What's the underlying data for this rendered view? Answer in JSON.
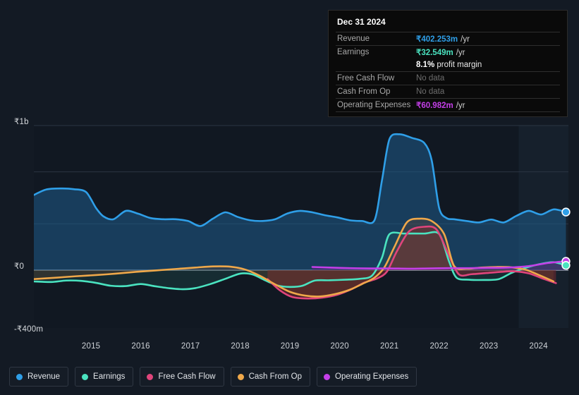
{
  "currency_symbol": "₹",
  "background": "#131a24",
  "tooltip": {
    "date": "Dec 31 2024",
    "rows": [
      {
        "label": "Revenue",
        "value": "₹402.253m",
        "unit": "/yr",
        "color": "#2f9fe8",
        "nodata": false
      },
      {
        "label": "Earnings",
        "value": "₹32.549m",
        "unit": "/yr",
        "color": "#4ae3c0",
        "nodata": false
      },
      {
        "label": "",
        "value": "8.1%",
        "unit": "profit margin",
        "color": "#ffffff",
        "nodata": false,
        "margin_row": true
      },
      {
        "label": "Free Cash Flow",
        "value": "No data",
        "unit": "",
        "color": "#6d6d6d",
        "nodata": true
      },
      {
        "label": "Cash From Op",
        "value": "No data",
        "unit": "",
        "color": "#6d6d6d",
        "nodata": true
      },
      {
        "label": "Operating Expenses",
        "value": "₹60.982m",
        "unit": "/yr",
        "color": "#c43fe8",
        "nodata": false
      }
    ]
  },
  "legend": {
    "items": [
      {
        "label": "Revenue",
        "color": "#2f9fe8"
      },
      {
        "label": "Earnings",
        "color": "#4ae3c0"
      },
      {
        "label": "Free Cash Flow",
        "color": "#e0457b"
      },
      {
        "label": "Cash From Op",
        "color": "#efa84a"
      },
      {
        "label": "Operating Expenses",
        "color": "#c43fe8"
      }
    ]
  },
  "chart_data": {
    "type": "area",
    "title": "",
    "xlabel": "",
    "ylabel": "",
    "ylim": [
      -400,
      1000
    ],
    "y_unit": "m",
    "grid": true,
    "legend_position": "bottom",
    "y_ticks": [
      {
        "label": "₹1b",
        "value": 1000
      },
      {
        "label": "₹0",
        "value": 0
      },
      {
        "label": "-₹400m",
        "value": -400
      }
    ],
    "gridlines": [
      1000,
      680,
      320,
      0
    ],
    "x_ticks": [
      "2015",
      "2016",
      "2017",
      "2018",
      "2019",
      "2020",
      "2021",
      "2022",
      "2023",
      "2024"
    ],
    "x_range": [
      2014.35,
      2025.1
    ],
    "forecast_start": 2024.1,
    "series": [
      {
        "name": "Revenue",
        "color": "#2f9fe8",
        "fill": "rgba(31,92,140,0.55)",
        "x": [
          2014.35,
          2014.6,
          2014.9,
          2015.15,
          2015.4,
          2015.6,
          2015.75,
          2015.95,
          2016.2,
          2016.45,
          2016.7,
          2016.95,
          2017.2,
          2017.45,
          2017.7,
          2017.95,
          2018.2,
          2018.45,
          2018.7,
          2018.95,
          2019.2,
          2019.45,
          2019.7,
          2019.95,
          2020.2,
          2020.45,
          2020.7,
          2020.95,
          2021.2,
          2021.35,
          2021.5,
          2021.7,
          2021.95,
          2022.2,
          2022.35,
          2022.5,
          2022.65,
          2022.8,
          2023.05,
          2023.3,
          2023.55,
          2023.8,
          2024.05,
          2024.3,
          2024.55,
          2024.8,
          2025.05
        ],
        "y": [
          520,
          558,
          565,
          560,
          540,
          430,
          372,
          352,
          410,
          390,
          360,
          352,
          352,
          340,
          305,
          356,
          400,
          368,
          345,
          340,
          352,
          392,
          410,
          400,
          380,
          365,
          345,
          340,
          345,
          620,
          905,
          940,
          915,
          880,
          760,
          430,
          360,
          352,
          340,
          330,
          350,
          330,
          375,
          410,
          385,
          420,
          402
        ]
      },
      {
        "name": "Earnings",
        "color": "#4ae3c0",
        "fill": "rgba(38,94,90,0.30)",
        "x": [
          2014.35,
          2014.7,
          2015.0,
          2015.3,
          2015.6,
          2015.9,
          2016.2,
          2016.5,
          2016.8,
          2017.1,
          2017.35,
          2017.6,
          2017.9,
          2018.2,
          2018.5,
          2018.75,
          2019.0,
          2019.25,
          2019.5,
          2019.75,
          2020.0,
          2020.3,
          2020.6,
          2020.9,
          2021.15,
          2021.35,
          2021.5,
          2021.8,
          2022.2,
          2022.5,
          2022.7,
          2022.85,
          2023.1,
          2023.4,
          2023.7,
          2023.95,
          2024.2,
          2024.5,
          2024.8,
          2025.05
        ],
        "y": [
          -78,
          -82,
          -72,
          -74,
          -88,
          -108,
          -110,
          -96,
          -112,
          -126,
          -132,
          -124,
          -96,
          -60,
          -24,
          -30,
          -70,
          -106,
          -116,
          -108,
          -72,
          -70,
          -66,
          -60,
          -38,
          86,
          248,
          253,
          253,
          250,
          60,
          -52,
          -66,
          -68,
          -62,
          -20,
          12,
          40,
          55,
          33
        ]
      },
      {
        "name": "Free Cash Flow",
        "color": "#e0457b",
        "fill": "rgba(120,40,48,0.55)",
        "x": [
          2019.05,
          2019.3,
          2019.55,
          2019.85,
          2020.15,
          2020.45,
          2020.75,
          2021.0,
          2021.25,
          2021.45,
          2021.65,
          2021.9,
          2022.2,
          2022.45,
          2022.7,
          2022.9,
          2023.15,
          2023.45,
          2023.75,
          2024.0,
          2024.3,
          2024.6,
          2024.85
        ],
        "y": [
          -62,
          -140,
          -186,
          -196,
          -190,
          -170,
          -130,
          -86,
          -58,
          -10,
          130,
          270,
          300,
          280,
          100,
          -30,
          -28,
          -20,
          -12,
          -8,
          -22,
          -60,
          -90
        ]
      },
      {
        "name": "Cash From Op",
        "color": "#efa84a",
        "fill": "rgba(120,72,42,0.28)",
        "x": [
          2014.35,
          2014.8,
          2015.2,
          2015.6,
          2016.0,
          2016.4,
          2016.8,
          2017.2,
          2017.6,
          2017.95,
          2018.3,
          2018.6,
          2018.9,
          2019.2,
          2019.5,
          2019.8,
          2020.1,
          2020.4,
          2020.7,
          2020.95,
          2021.2,
          2021.4,
          2021.6,
          2021.85,
          2022.1,
          2022.35,
          2022.6,
          2022.8,
          2023.05,
          2023.35,
          2023.65,
          2023.95,
          2024.25,
          2024.55,
          2024.8
        ],
        "y": [
          -62,
          -52,
          -42,
          -34,
          -24,
          -12,
          -2,
          8,
          18,
          26,
          24,
          4,
          -40,
          -98,
          -150,
          -176,
          -182,
          -166,
          -136,
          -96,
          -52,
          20,
          160,
          330,
          356,
          340,
          250,
          30,
          10,
          18,
          22,
          20,
          2,
          -40,
          -78
        ]
      },
      {
        "name": "Operating Expenses",
        "color": "#c43fe8",
        "fill": "rgba(92,38,122,0.50)",
        "x": [
          2019.95,
          2020.3,
          2020.7,
          2021.1,
          2021.5,
          2021.9,
          2022.3,
          2022.7,
          2023.1,
          2023.5,
          2023.9,
          2024.3,
          2024.7,
          2025.05
        ],
        "y": [
          22,
          18,
          14,
          12,
          12,
          10,
          12,
          14,
          14,
          16,
          18,
          28,
          50,
          61
        ]
      }
    ],
    "endpoints": [
      {
        "name": "Revenue",
        "color": "#2f9fe8",
        "x": 2025.05,
        "y": 402
      },
      {
        "name": "Operating Expenses",
        "color": "#c43fe8",
        "x": 2025.05,
        "y": 61
      },
      {
        "name": "Earnings",
        "color": "#4ae3c0",
        "x": 2025.05,
        "y": 33
      }
    ]
  }
}
